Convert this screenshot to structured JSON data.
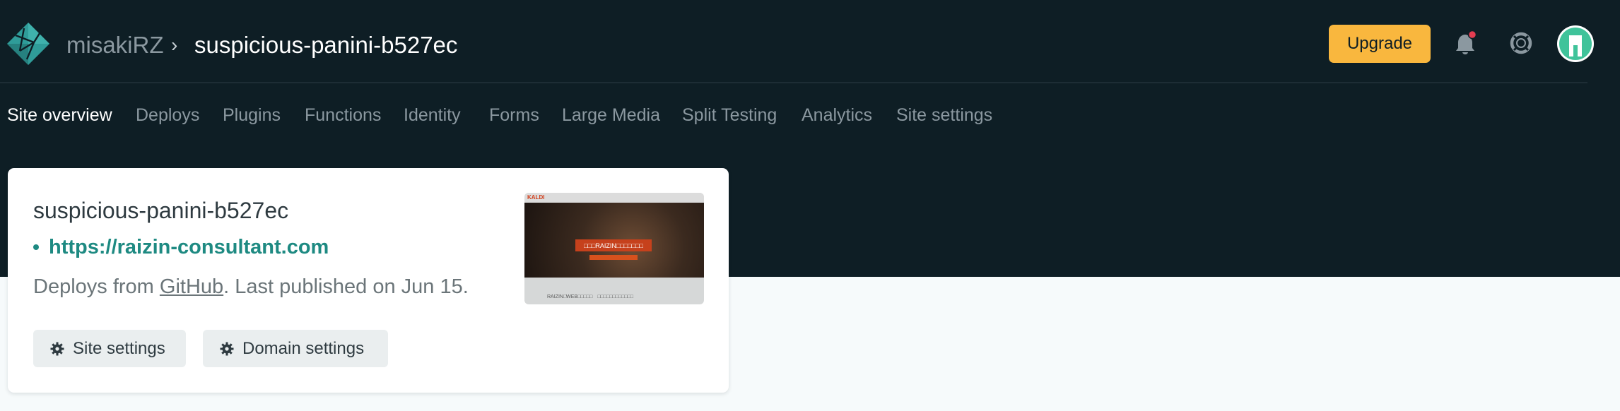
{
  "header": {
    "team_name": "misakiRZ",
    "separator": "›",
    "site_name": "suspicious-panini-b527ec",
    "upgrade_label": "Upgrade",
    "accent_color": "#f9b73e",
    "notification_dot_color": "#e33d51",
    "icons": [
      "netlify-logo-icon",
      "chevron-right-icon",
      "bell-icon",
      "help-lifebuoy-icon",
      "avatar"
    ]
  },
  "nav": {
    "tabs": [
      {
        "label": "Site overview",
        "active": true
      },
      {
        "label": "Deploys",
        "active": false
      },
      {
        "label": "Plugins",
        "active": false
      },
      {
        "label": "Functions",
        "active": false
      },
      {
        "label": "Identity",
        "active": false
      },
      {
        "label": "Forms",
        "active": false
      },
      {
        "label": "Large Media",
        "active": false
      },
      {
        "label": "Split Testing",
        "active": false
      },
      {
        "label": "Analytics",
        "active": false
      },
      {
        "label": "Site settings",
        "active": false
      }
    ]
  },
  "card": {
    "title": "suspicious-panini-b527ec",
    "url": "https://raizin-consultant.com",
    "deploy_prefix": "Deploys from ",
    "deploy_source": "GitHub",
    "deploy_suffix": ". Last published on Jun 15.",
    "site_settings_label": "Site settings",
    "domain_settings_label": "Domain settings",
    "link_color": "#1e8a82",
    "thumbnail": {
      "brand": "KALDI",
      "headline": "□□□RAIZIN□□□□□□□",
      "footer": "RAIZIN□WEB□□□□□　□□□□□□□□□□□□"
    }
  }
}
